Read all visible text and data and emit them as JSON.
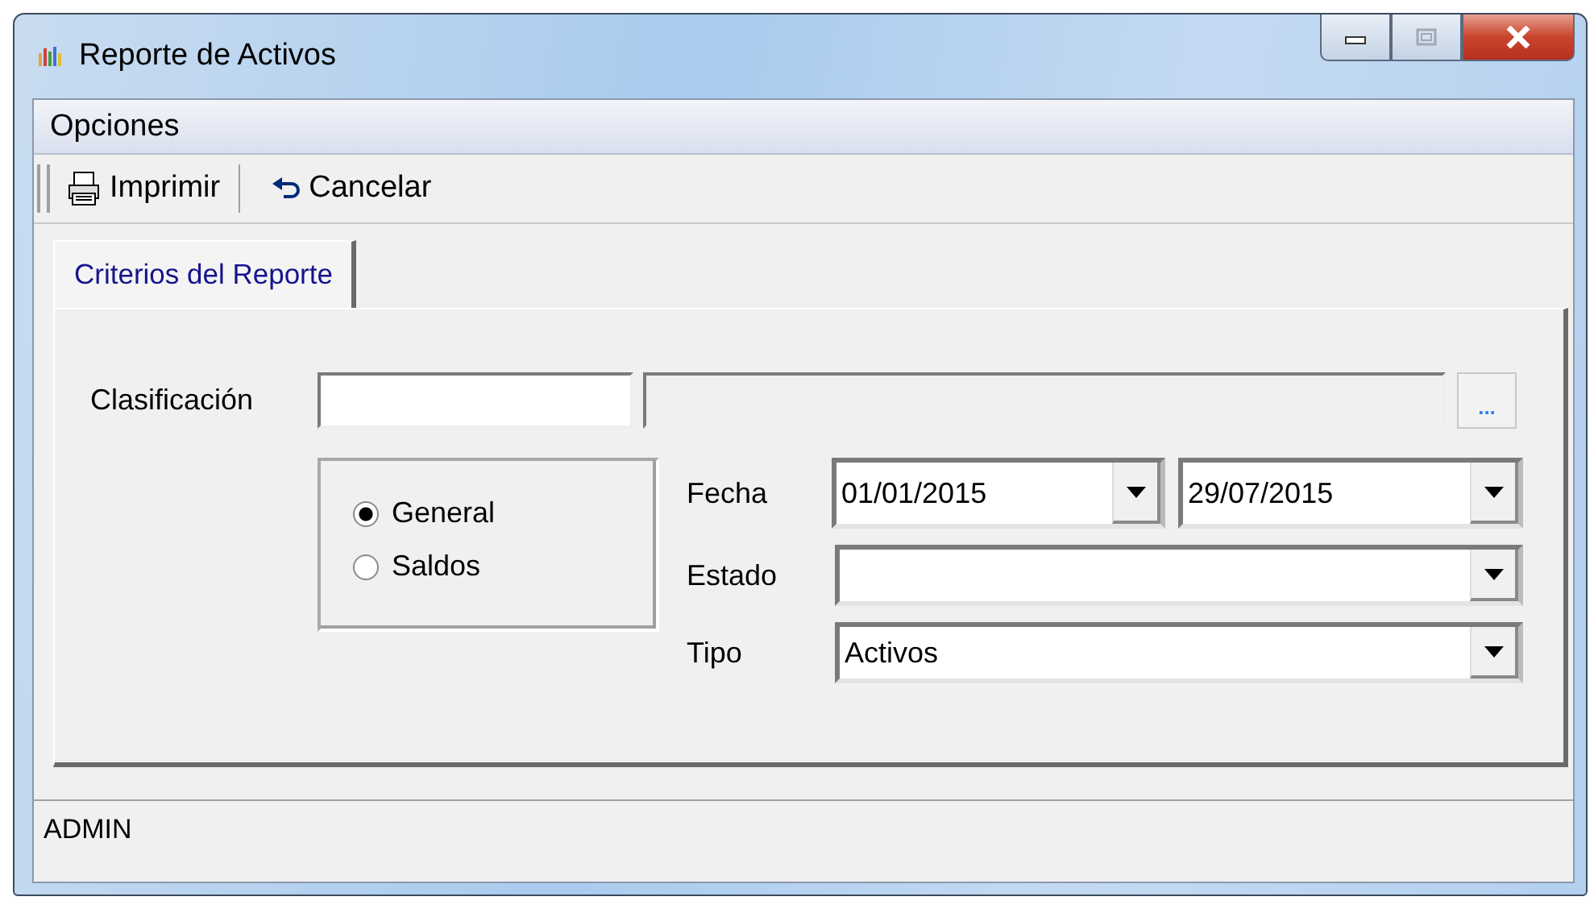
{
  "window": {
    "title": "Reporte de Activos"
  },
  "menu": [
    {
      "label": "Opciones"
    }
  ],
  "toolbar": [
    {
      "label": "Imprimir",
      "kind": "print"
    },
    {
      "label": "Cancelar",
      "kind": "undo"
    }
  ],
  "tabs": [
    {
      "label": "Criterios del Reporte",
      "selected": true
    }
  ],
  "form": {
    "clasificacion": {
      "label": "Clasificación",
      "browse": "..."
    },
    "options": [
      {
        "label": "General",
        "selected": true
      },
      {
        "label": "Saldos",
        "selected": false
      }
    ],
    "fecha": {
      "label": "Fecha",
      "from": "01/01/2015",
      "to": "29/07/2015"
    },
    "estado": {
      "label": "Estado"
    },
    "tipo": {
      "label": "Tipo",
      "value": "Activos"
    }
  },
  "status_bar": {
    "user": "ADMIN"
  }
}
